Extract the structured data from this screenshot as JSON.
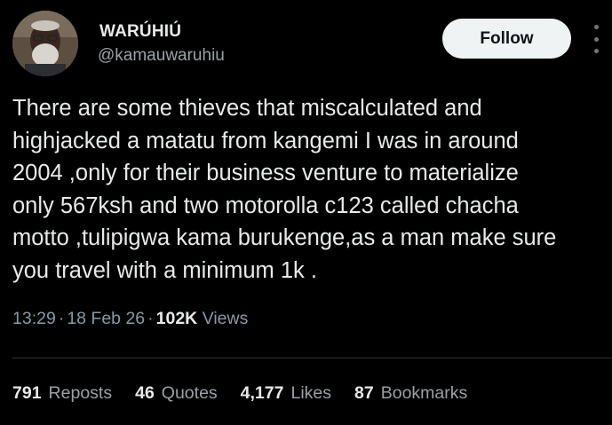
{
  "author": {
    "display_name": "WARÚHIÚ",
    "handle": "@kamauwaruhiu"
  },
  "follow_label": "Follow",
  "tweet": {
    "text": "There are some thieves that miscalculated and\nhighjacked a matatu from kangemi  I was in around\n2004 ,only for their business venture to materialize\nonly 567ksh and two motorolla c123 called chacha\nmotto ,tulipigwa kama burukenge,as a man make sure\nyou travel with a minimum 1k ."
  },
  "meta": {
    "time": "13:29",
    "date": "18 Feb 26",
    "views_count": "102K",
    "views_label": "Views"
  },
  "stats": {
    "reposts": {
      "count": "791",
      "label": "Reposts"
    },
    "quotes": {
      "count": "46",
      "label": "Quotes"
    },
    "likes": {
      "count": "4,177",
      "label": "Likes"
    },
    "bookmarks": {
      "count": "87",
      "label": "Bookmarks"
    }
  },
  "colors": {
    "background": "#000000",
    "text_primary": "#e7e9ea",
    "text_secondary": "#8b98a5",
    "follow_bg": "#eff3f4",
    "divider": "#2f3336"
  },
  "icons": {
    "more": "more-vertical-icon"
  }
}
